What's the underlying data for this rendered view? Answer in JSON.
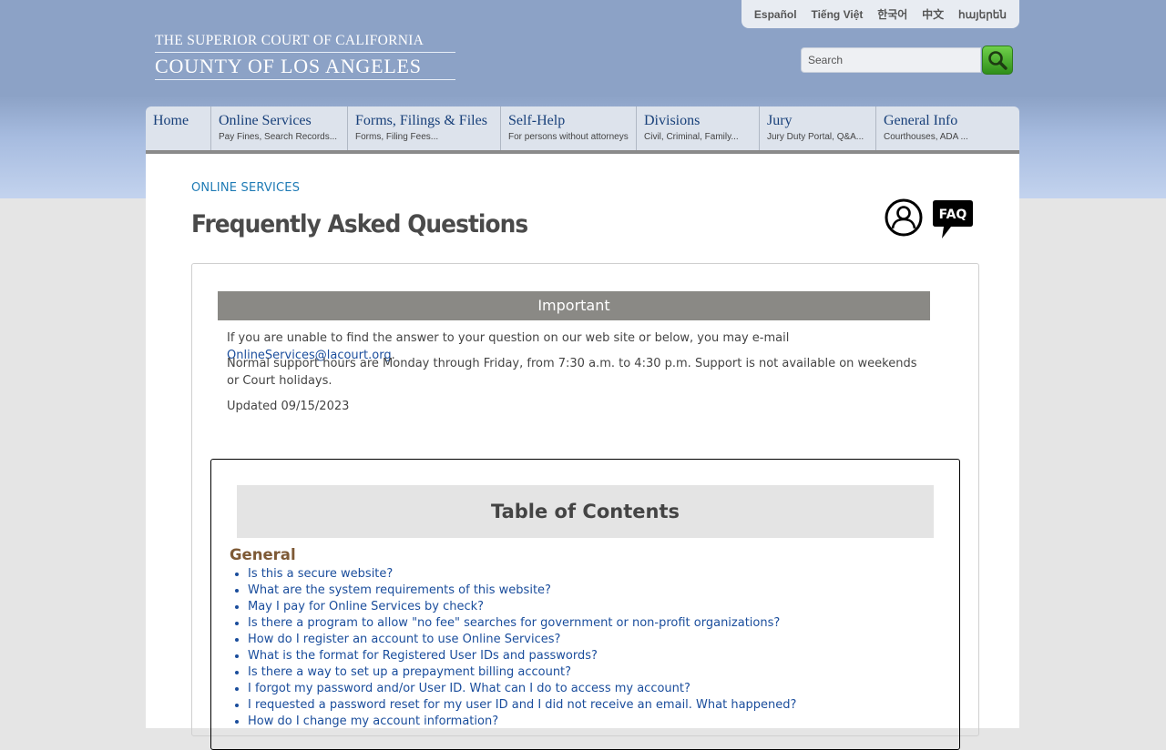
{
  "languages": [
    "Español",
    "Tiếng Việt",
    "한국어",
    "中文",
    "հայերեն"
  ],
  "logo": {
    "line1": "THE SUPERIOR COURT OF CALIFORNIA",
    "line2": "COUNTY OF LOS ANGELES"
  },
  "search": {
    "placeholder": "Search",
    "icon": "magnifier-icon"
  },
  "nav": [
    {
      "title": "Home",
      "sub": ""
    },
    {
      "title": "Online Services",
      "sub": "Pay Fines, Search Records..."
    },
    {
      "title": "Forms, Filings & Files",
      "sub": "Forms, Filing Fees..."
    },
    {
      "title": "Self-Help",
      "sub": "For persons without attorneys"
    },
    {
      "title": "Divisions",
      "sub": "Civil, Criminal, Family..."
    },
    {
      "title": "Jury",
      "sub": "Jury Duty Portal, Q&A..."
    },
    {
      "title": "General Info",
      "sub": "Courthouses, ADA ..."
    }
  ],
  "breadcrumb": "ONLINE SERVICES",
  "page_title": "Frequently Asked Questions",
  "faq_icon_text": "FAQ",
  "important": {
    "header": "Important",
    "line1_prefix": "If you are unable to find the answer to your question on our web site or below, you may e-mail ",
    "email": "OnlineServices@lacourt.org",
    "line1_suffix": ".",
    "line2": "Normal support hours are Monday through Friday, from 7:30 a.m. to 4:30 p.m. Support is not available on weekends or Court holidays.",
    "updated": "Updated 09/15/2023"
  },
  "toc": {
    "title": "Table of Contents",
    "section": "General",
    "items": [
      "Is this a secure website?",
      "What are the system requirements of this website?",
      "May I pay for Online Services by check?",
      "Is there a program to allow \"no fee\" searches for government or non-profit organizations?",
      "How do I register an account to use Online Services?",
      "What is the format for Registered User IDs and passwords?",
      "Is there a way to set up a prepayment billing account?",
      "I forgot my password and/or User ID. What can I do to access my account?",
      "I requested a password reset for my user ID and I did not receive an email. What happened?",
      "How do I change my account information?"
    ]
  },
  "colors": {
    "header_blue": "#8ca2c6",
    "nav_bg": "#dde3ec",
    "nav_text": "#18407a",
    "link": "#1a4d9c",
    "breadcrumb": "#1f7bb5",
    "important_bar": "#8a8985",
    "section_title": "#7e5a36",
    "search_button": "#3fa826"
  }
}
